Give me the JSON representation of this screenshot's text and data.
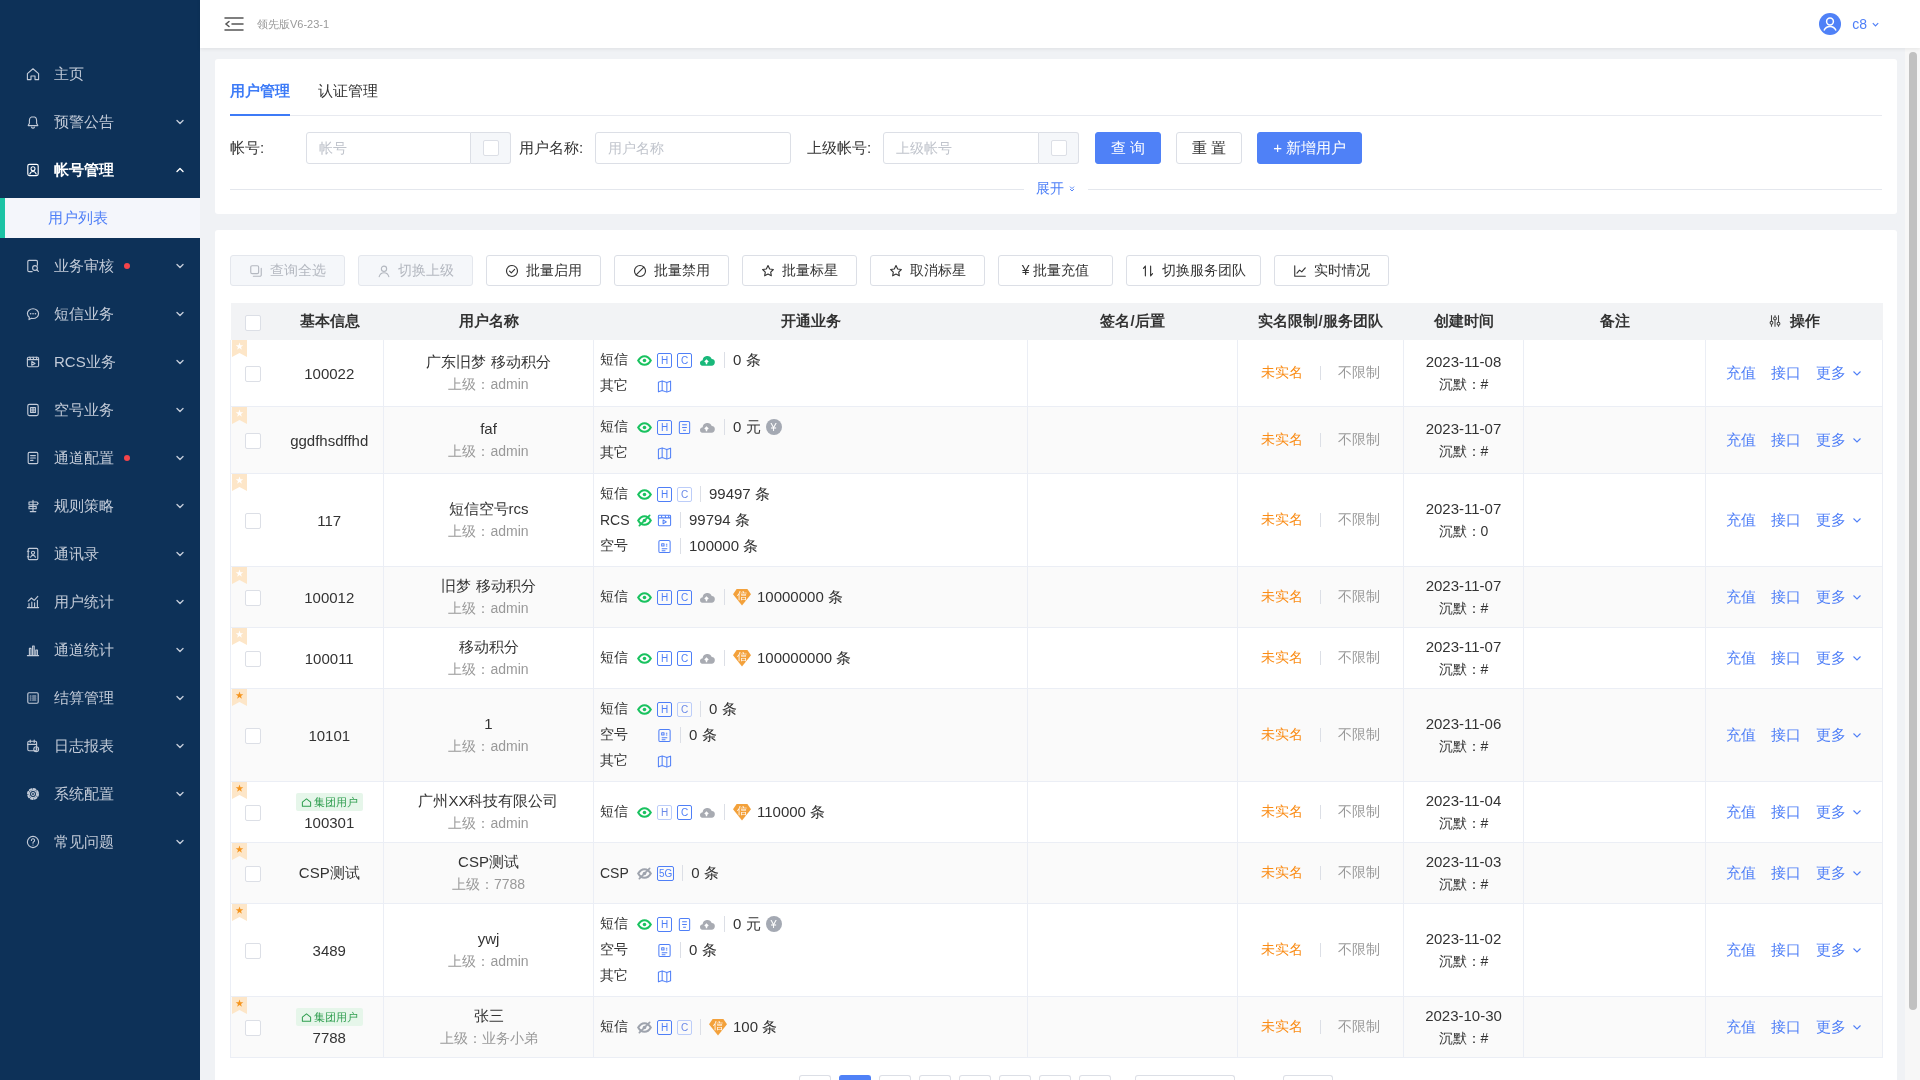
{
  "header": {
    "version": "领先版V6-23-1",
    "user": "c8"
  },
  "sidebar": {
    "items": [
      {
        "label": "主页",
        "kind": "link",
        "selected": false,
        "expanded": false,
        "alert": false
      },
      {
        "label": "预警公告",
        "kind": "group",
        "selected": false,
        "expanded": false,
        "alert": false
      },
      {
        "label": "帐号管理",
        "kind": "group",
        "selected": false,
        "expanded": true,
        "alert": false,
        "children": [
          {
            "label": "用户列表",
            "selected": true
          }
        ]
      },
      {
        "label": "业务审核",
        "kind": "group",
        "selected": false,
        "expanded": false,
        "alert": true
      },
      {
        "label": "短信业务",
        "kind": "group",
        "selected": false,
        "expanded": false,
        "alert": false
      },
      {
        "label": "RCS业务",
        "kind": "group",
        "selected": false,
        "expanded": false,
        "alert": false
      },
      {
        "label": "空号业务",
        "kind": "group",
        "selected": false,
        "expanded": false,
        "alert": false
      },
      {
        "label": "通道配置",
        "kind": "group",
        "selected": false,
        "expanded": false,
        "alert": true
      },
      {
        "label": "规则策略",
        "kind": "group",
        "selected": false,
        "expanded": false,
        "alert": false
      },
      {
        "label": "通讯录",
        "kind": "group",
        "selected": false,
        "expanded": false,
        "alert": false
      },
      {
        "label": "用户统计",
        "kind": "group",
        "selected": false,
        "expanded": false,
        "alert": false
      },
      {
        "label": "通道统计",
        "kind": "group",
        "selected": false,
        "expanded": false,
        "alert": false
      },
      {
        "label": "结算管理",
        "kind": "group",
        "selected": false,
        "expanded": false,
        "alert": false
      },
      {
        "label": "日志报表",
        "kind": "group",
        "selected": false,
        "expanded": false,
        "alert": false
      },
      {
        "label": "系统配置",
        "kind": "group",
        "selected": false,
        "expanded": false,
        "alert": false
      },
      {
        "label": "常见问题",
        "kind": "group",
        "selected": false,
        "expanded": false,
        "alert": false
      }
    ]
  },
  "tabs": [
    {
      "label": "用户管理",
      "selected": true
    },
    {
      "label": "认证管理",
      "selected": false
    }
  ],
  "filter": {
    "fields": [
      {
        "label": "帐号:",
        "placeholder": "帐号",
        "checkbox": {
          "checked": false
        }
      },
      {
        "label": "用户名称:",
        "placeholder": "用户名称"
      },
      {
        "label": "上级帐号:",
        "placeholder": "上级帐号",
        "checkbox": {
          "checked": false
        }
      }
    ],
    "buttons": [
      {
        "label": "查 询",
        "kind": "primary"
      },
      {
        "label": "重 置",
        "kind": "default"
      },
      {
        "label": "+ 新增用户",
        "kind": "primary"
      }
    ],
    "expand": {
      "label": "展开",
      "expanded": false
    }
  },
  "toolbar": [
    {
      "label": "查询全选",
      "disabled": true
    },
    {
      "label": "切换上级",
      "disabled": true
    },
    {
      "label": "批量启用",
      "disabled": false
    },
    {
      "label": "批量禁用",
      "disabled": false
    },
    {
      "label": "批量标星",
      "disabled": false
    },
    {
      "label": "取消标星",
      "disabled": false
    },
    {
      "label": "¥ 批量充值",
      "disabled": false
    },
    {
      "label": "切换服务团队",
      "disabled": false
    },
    {
      "label": "实时情况",
      "disabled": false
    }
  ],
  "table": {
    "select_all": {
      "checked": false
    },
    "columns": [
      {
        "label": "基本信息"
      },
      {
        "label": "用户名称"
      },
      {
        "label": "开通业务"
      },
      {
        "label": "签名/后置"
      },
      {
        "label": "实名限制/服务团队"
      },
      {
        "label": "创建时间"
      },
      {
        "label": "备注"
      },
      {
        "label": "操作"
      }
    ],
    "rows": [
      {
        "starred": false,
        "checked": false,
        "account": "100022",
        "name": "广东旧梦 移动积分",
        "parent": "上级：admin",
        "services": [
          {
            "label": "短信",
            "eye": {
              "enabled": true,
              "slashed": false
            },
            "icons": [
              {
                "kind": "letter",
                "text": "H",
                "enabled": true
              },
              {
                "kind": "letter",
                "text": "C",
                "enabled": true
              },
              {
                "kind": "cloud",
                "enabled": true
              }
            ],
            "count": "0 条"
          },
          {
            "label": "其它",
            "icons": [
              {
                "kind": "other"
              }
            ]
          }
        ],
        "realname": "未实名",
        "limit": "不限制",
        "created": "2023-11-08",
        "silent": "沉默：#",
        "actions": [
          "充值",
          "接口",
          "更多"
        ]
      },
      {
        "starred": false,
        "checked": false,
        "account": "ggdfhsdffhd",
        "name": "faf",
        "parent": "上级：admin",
        "services": [
          {
            "label": "短信",
            "eye": {
              "enabled": true,
              "slashed": false
            },
            "icons": [
              {
                "kind": "letter",
                "text": "H",
                "enabled": true
              },
              {
                "kind": "phone"
              },
              {
                "kind": "cloud",
                "enabled": false
              }
            ],
            "count": "0 元",
            "suffix": "¥"
          },
          {
            "label": "其它",
            "icons": [
              {
                "kind": "other"
              }
            ]
          }
        ],
        "realname": "未实名",
        "limit": "不限制",
        "created": "2023-11-07",
        "silent": "沉默：#",
        "actions": [
          "充值",
          "接口",
          "更多"
        ]
      },
      {
        "starred": false,
        "checked": false,
        "account": "117",
        "name": "短信空号rcs",
        "parent": "上级：admin",
        "services": [
          {
            "label": "短信",
            "eye": {
              "enabled": true,
              "slashed": false
            },
            "icons": [
              {
                "kind": "letter",
                "text": "H",
                "enabled": true
              },
              {
                "kind": "letter",
                "text": "C",
                "enabled": false
              }
            ],
            "count": "99497 条"
          },
          {
            "label": "RCS",
            "eye": {
              "enabled": true,
              "slashed": true
            },
            "icons": [
              {
                "kind": "rcs"
              }
            ],
            "count": "99794 条"
          },
          {
            "label": "空号",
            "icons": [
              {
                "kind": "number"
              }
            ],
            "count": "100000 条"
          }
        ],
        "realname": "未实名",
        "limit": "不限制",
        "created": "2023-11-07",
        "silent": "沉默：0",
        "actions": [
          "充值",
          "接口",
          "更多"
        ]
      },
      {
        "starred": false,
        "checked": false,
        "account": "100012",
        "name": "旧梦 移动积分",
        "parent": "上级：admin",
        "services": [
          {
            "label": "短信",
            "eye": {
              "enabled": true,
              "slashed": false
            },
            "icons": [
              {
                "kind": "letter",
                "text": "H",
                "enabled": true
              },
              {
                "kind": "letter",
                "text": "C",
                "enabled": true
              },
              {
                "kind": "cloud",
                "enabled": false
              }
            ],
            "badge": "信",
            "count": "10000000 条"
          }
        ],
        "realname": "未实名",
        "limit": "不限制",
        "created": "2023-11-07",
        "silent": "沉默：#",
        "actions": [
          "充值",
          "接口",
          "更多"
        ]
      },
      {
        "starred": false,
        "checked": false,
        "account": "100011",
        "name": "移动积分",
        "parent": "上级：admin",
        "services": [
          {
            "label": "短信",
            "eye": {
              "enabled": true,
              "slashed": false
            },
            "icons": [
              {
                "kind": "letter",
                "text": "H",
                "enabled": true
              },
              {
                "kind": "letter",
                "text": "C",
                "enabled": true
              },
              {
                "kind": "cloud",
                "enabled": false
              }
            ],
            "badge": "信",
            "count": "100000000 条"
          }
        ],
        "realname": "未实名",
        "limit": "不限制",
        "created": "2023-11-07",
        "silent": "沉默：#",
        "actions": [
          "充值",
          "接口",
          "更多"
        ]
      },
      {
        "starred": true,
        "checked": false,
        "account": "10101",
        "name": "1",
        "parent": "上级：admin",
        "services": [
          {
            "label": "短信",
            "eye": {
              "enabled": true,
              "slashed": false
            },
            "icons": [
              {
                "kind": "letter",
                "text": "H",
                "enabled": true
              },
              {
                "kind": "letter",
                "text": "C",
                "enabled": false
              }
            ],
            "count": "0 条"
          },
          {
            "label": "空号",
            "icons": [
              {
                "kind": "number"
              }
            ],
            "count": "0 条"
          },
          {
            "label": "其它",
            "icons": [
              {
                "kind": "other"
              }
            ]
          }
        ],
        "realname": "未实名",
        "limit": "不限制",
        "created": "2023-11-06",
        "silent": "沉默：#",
        "actions": [
          "充值",
          "接口",
          "更多"
        ]
      },
      {
        "starred": true,
        "checked": false,
        "tag": "集团用户",
        "account": "100301",
        "name": "广州XX科技有限公司",
        "parent": "上级：admin",
        "services": [
          {
            "label": "短信",
            "eye": {
              "enabled": true,
              "slashed": false
            },
            "icons": [
              {
                "kind": "letter",
                "text": "H",
                "enabled": false
              },
              {
                "kind": "letter",
                "text": "C",
                "enabled": true
              },
              {
                "kind": "cloud",
                "enabled": false
              }
            ],
            "badge": "信",
            "count": "110000 条"
          }
        ],
        "realname": "未实名",
        "limit": "不限制",
        "created": "2023-11-04",
        "silent": "沉默：#",
        "actions": [
          "充值",
          "接口",
          "更多"
        ]
      },
      {
        "starred": true,
        "checked": false,
        "account": "CSP测试",
        "name": "CSP测试",
        "parent": "上级：7788",
        "services": [
          {
            "label": "CSP",
            "eye": {
              "enabled": false,
              "slashed": true
            },
            "icons": [
              {
                "kind": "letter",
                "text": "5G",
                "enabled": true
              }
            ],
            "count": "0 条"
          }
        ],
        "realname": "未实名",
        "limit": "不限制",
        "created": "2023-11-03",
        "silent": "沉默：#",
        "actions": [
          "充值",
          "接口",
          "更多"
        ]
      },
      {
        "starred": true,
        "checked": false,
        "account": "3489",
        "name": "ywj",
        "parent": "上级：admin",
        "services": [
          {
            "label": "短信",
            "eye": {
              "enabled": true,
              "slashed": false
            },
            "icons": [
              {
                "kind": "letter",
                "text": "H",
                "enabled": true
              },
              {
                "kind": "phone"
              },
              {
                "kind": "cloud",
                "enabled": false
              }
            ],
            "count": "0 元",
            "suffix": "¥"
          },
          {
            "label": "空号",
            "icons": [
              {
                "kind": "number"
              }
            ],
            "count": "0 条"
          },
          {
            "label": "其它",
            "icons": [
              {
                "kind": "other"
              }
            ]
          }
        ],
        "realname": "未实名",
        "limit": "不限制",
        "created": "2023-11-02",
        "silent": "沉默：#",
        "actions": [
          "充值",
          "接口",
          "更多"
        ]
      },
      {
        "starred": true,
        "checked": false,
        "tag": "集团用户",
        "account": "7788",
        "name": "张三",
        "parent": "上级：业务小弟",
        "services": [
          {
            "label": "短信",
            "eye": {
              "enabled": false,
              "slashed": true
            },
            "icons": [
              {
                "kind": "letter",
                "text": "H",
                "enabled": true
              },
              {
                "kind": "letter",
                "text": "C",
                "enabled": false
              }
            ],
            "badge": "信",
            "count": "100 条"
          }
        ],
        "realname": "未实名",
        "limit": "不限制",
        "created": "2023-10-30",
        "silent": "沉默：#",
        "actions": [
          "充值",
          "接口",
          "更多"
        ]
      }
    ]
  },
  "pagination": [
    {
      "kind": "page",
      "selected": false
    },
    {
      "kind": "page",
      "selected": true
    },
    {
      "kind": "page",
      "selected": false
    },
    {
      "kind": "page",
      "selected": false
    },
    {
      "kind": "page",
      "selected": false
    },
    {
      "kind": "page",
      "selected": false
    },
    {
      "kind": "page",
      "selected": false
    },
    {
      "kind": "page",
      "selected": false
    },
    {
      "kind": "select",
      "selected": false
    },
    {
      "kind": "jumper",
      "selected": false
    }
  ]
}
